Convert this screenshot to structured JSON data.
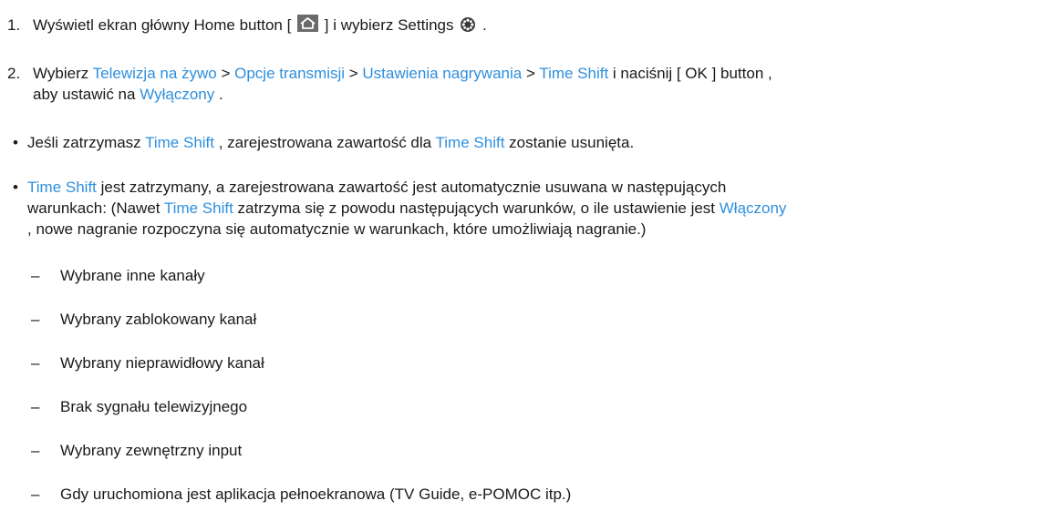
{
  "step1": {
    "num": "1.",
    "prefix": "Wyświetl ekran główny Home button [",
    "icon1": "home-icon",
    "mid": "] i wybierz Settings",
    "icon2": "gear-icon",
    "suffix": "."
  },
  "step2": {
    "num": "2.",
    "t1": "Wybierz ",
    "l1": "Telewizja na żywo",
    "s1": " > ",
    "l2": "Opcje transmisji",
    "s2": " > ",
    "l3": "Ustawienia nagrywania",
    "s3": " > ",
    "l4": "Time Shift",
    "t2": " i naciśnij [ OK ] button ,",
    "t3": "aby ustawić na ",
    "l5": "Wyłączony",
    "t4": " ."
  },
  "bullet1": {
    "marker": "•",
    "t1": "Jeśli zatrzymasz ",
    "l1": "Time Shift",
    "t2": " , zarejestrowana zawartość dla ",
    "l2": "Time Shift",
    "t3": " zostanie usunięta."
  },
  "bullet2": {
    "marker": "•",
    "l1": "Time Shift",
    "t1": " jest zatrzymany, a zarejestrowana zawartość jest automatycznie usuwana w następujących",
    "t2": "warunkach: (Nawet ",
    "l2": "Time Shift",
    "t3": " zatrzyma się z powodu następujących warunków, o ile ustawienie jest ",
    "l3": "Włączony",
    "t4": ", nowe nagranie rozpoczyna się automatycznie w warunkach, które umożliwiają nagranie.)"
  },
  "conditions": {
    "marker": "–",
    "items": [
      "Wybrane inne kanały",
      "Wybrany zablokowany kanał",
      "Wybrany nieprawidłowy kanał",
      "Brak sygnału telewizyjnego",
      "Wybrany zewnętrzny input",
      "Gdy uruchomiona jest aplikacja pełnoekranowa (TV Guide, e-POMOC itp.)"
    ]
  },
  "colors": {
    "link": "#2f8fdd",
    "text": "#1a1a1a"
  }
}
